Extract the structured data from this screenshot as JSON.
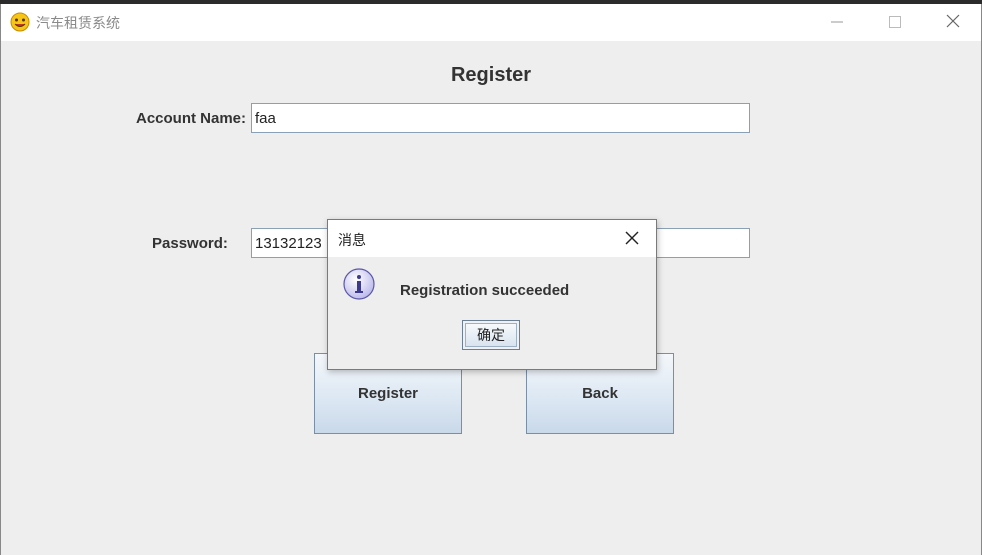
{
  "window": {
    "title": "汽车租赁系统",
    "app_icon": "smiley-face-icon",
    "controls": [
      "minimize-icon",
      "maximize-icon",
      "close-icon"
    ]
  },
  "form": {
    "heading": "Register",
    "account_label": "Account Name:",
    "account_value": "faa",
    "password_label": "Password:",
    "password_value": "13132123",
    "register_button": "Register",
    "back_button": "Back"
  },
  "dialog": {
    "title": "消息",
    "icon": "info-icon",
    "message": "Registration succeeded",
    "ok_button": "确定"
  }
}
